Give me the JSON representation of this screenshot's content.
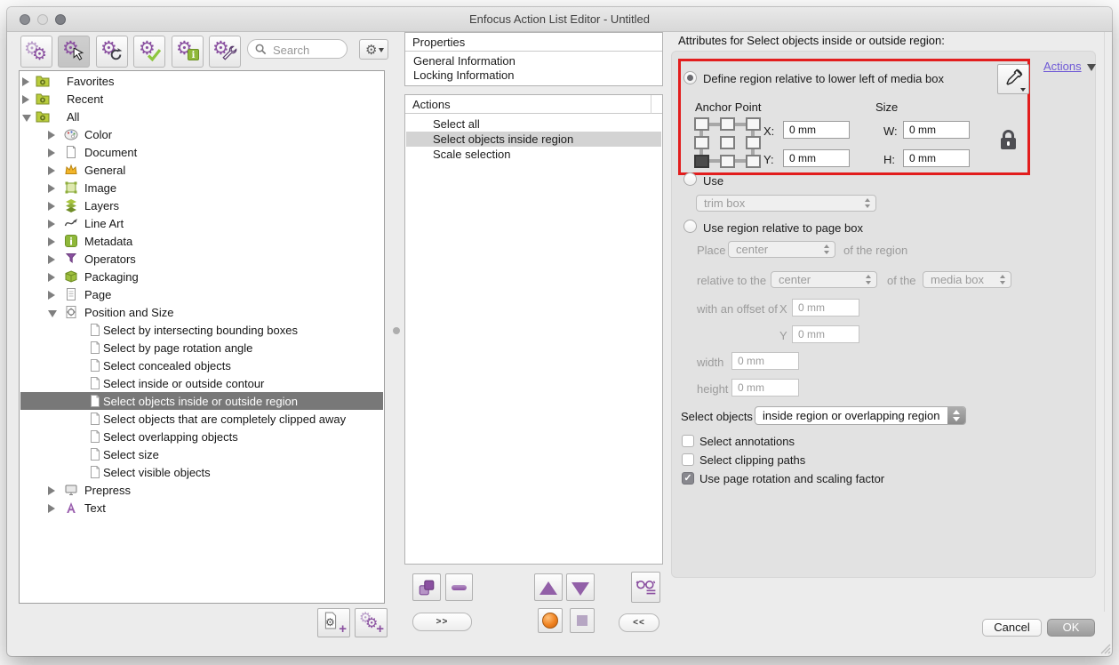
{
  "window": {
    "title": "Enfocus Action List Editor - Untitled"
  },
  "toolbar": {
    "search_placeholder": "Search",
    "buttons": [
      {
        "icon": "gears-double"
      },
      {
        "icon": "gear-cursor",
        "selected": true
      },
      {
        "icon": "gear-refresh"
      },
      {
        "icon": "gear-check"
      },
      {
        "icon": "gear-info"
      },
      {
        "icon": "gear-wrench"
      }
    ],
    "settings_menu_icon": "gear-dropdown"
  },
  "tree": {
    "items": [
      {
        "label": "Favorites",
        "level": 0,
        "icon": "folder-gear",
        "disclosure": "collapsed"
      },
      {
        "label": "Recent",
        "level": 0,
        "icon": "folder-gear",
        "disclosure": "collapsed"
      },
      {
        "label": "All",
        "level": 0,
        "icon": "folder-gear",
        "disclosure": "expanded"
      },
      {
        "label": "Color",
        "level": 1,
        "icon": "palette",
        "disclosure": "collapsed"
      },
      {
        "label": "Document",
        "level": 1,
        "icon": "document",
        "disclosure": "collapsed"
      },
      {
        "label": "General",
        "level": 1,
        "icon": "crown",
        "disclosure": "collapsed"
      },
      {
        "label": "Image",
        "level": 1,
        "icon": "image-frame",
        "disclosure": "collapsed"
      },
      {
        "label": "Layers",
        "level": 1,
        "icon": "layers",
        "disclosure": "collapsed"
      },
      {
        "label": "Line Art",
        "level": 1,
        "icon": "line-art",
        "disclosure": "collapsed"
      },
      {
        "label": "Metadata",
        "level": 1,
        "icon": "info-badge",
        "disclosure": "collapsed"
      },
      {
        "label": "Operators",
        "level": 1,
        "icon": "operators",
        "disclosure": "collapsed"
      },
      {
        "label": "Packaging",
        "level": 1,
        "icon": "package",
        "disclosure": "collapsed"
      },
      {
        "label": "Page",
        "level": 1,
        "icon": "page",
        "disclosure": "collapsed"
      },
      {
        "label": "Position and Size",
        "level": 1,
        "icon": "position-size",
        "disclosure": "expanded"
      },
      {
        "label": "Select by intersecting bounding boxes",
        "level": 2,
        "icon": "action-doc"
      },
      {
        "label": "Select by page rotation angle",
        "level": 2,
        "icon": "action-doc"
      },
      {
        "label": "Select concealed objects",
        "level": 2,
        "icon": "action-doc"
      },
      {
        "label": "Select inside or outside contour",
        "level": 2,
        "icon": "action-doc"
      },
      {
        "label": "Select objects inside or outside region",
        "level": 2,
        "icon": "action-doc",
        "selected": true
      },
      {
        "label": "Select objects that are completely clipped away",
        "level": 2,
        "icon": "action-doc"
      },
      {
        "label": "Select overlapping objects",
        "level": 2,
        "icon": "action-doc"
      },
      {
        "label": "Select size",
        "level": 2,
        "icon": "action-doc"
      },
      {
        "label": "Select visible objects",
        "level": 2,
        "icon": "action-doc"
      },
      {
        "label": "Prepress",
        "level": 1,
        "icon": "monitor",
        "disclosure": "collapsed"
      },
      {
        "label": "Text",
        "level": 1,
        "icon": "text-a",
        "disclosure": "collapsed"
      }
    ],
    "footer_buttons": [
      {
        "icon": "doc-gear-plus"
      },
      {
        "icon": "gears-plus"
      }
    ]
  },
  "properties_panel": {
    "header": "Properties",
    "items": [
      "General Information",
      "Locking Information"
    ]
  },
  "actions_panel": {
    "header": "Actions",
    "items": [
      {
        "label": "Select all"
      },
      {
        "label": "Select objects inside region",
        "selected": true
      },
      {
        "label": "Scale selection"
      }
    ]
  },
  "transport": {
    "forward_label": ">>",
    "back_label": "<<",
    "buttons": [
      {
        "icon": "duplicate"
      },
      {
        "icon": "minus"
      },
      {
        "icon": "move-up"
      },
      {
        "icon": "move-down"
      },
      {
        "icon": "preview-glasses"
      },
      {
        "icon": "record"
      },
      {
        "icon": "stop"
      }
    ]
  },
  "attributes": {
    "heading": "Attributes for Select objects inside or outside region:",
    "actions_link": "Actions",
    "radio_define": {
      "label": "Define region relative to lower left of media box",
      "selected": true
    },
    "anchor_point_label": "Anchor Point",
    "size_label": "Size",
    "x_label": "X:",
    "x_value": "0 mm",
    "y_label": "Y:",
    "y_value": "0 mm",
    "w_label": "W:",
    "w_value": "0 mm",
    "h_label": "H:",
    "h_value": "0 mm",
    "radio_use": {
      "label": "Use",
      "selected": false
    },
    "use_box_value": "trim box",
    "radio_page_box": {
      "label": "Use region relative to page box",
      "selected": false
    },
    "place_label": "Place",
    "place_value": "center",
    "of_the_region_label": "of the region",
    "relative_label": "relative to the",
    "relative_value": "center",
    "of_the_label": "of the",
    "of_box_value": "media box",
    "offset_label": "with an offset of",
    "offset_x_label": "X",
    "offset_x_value": "0 mm",
    "offset_y_label": "Y",
    "offset_y_value": "0 mm",
    "width_label": "width",
    "width_value": "0 mm",
    "height_label": "height",
    "height_value": "0 mm",
    "select_objects_label": "Select objects",
    "select_objects_value": "inside region or overlapping region",
    "checkboxes": [
      {
        "label": "Select annotations",
        "checked": false
      },
      {
        "label": "Select clipping paths",
        "checked": false
      },
      {
        "label": "Use page rotation and scaling factor",
        "checked": true
      }
    ]
  },
  "footer": {
    "cancel_label": "Cancel",
    "ok_label": "OK"
  }
}
